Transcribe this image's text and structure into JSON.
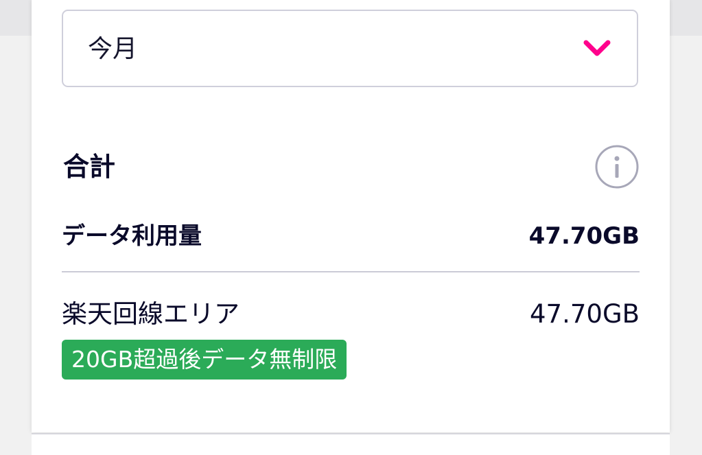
{
  "period_select": {
    "selected": "今月",
    "icon": "chevron-down-icon",
    "chevron_color": "#ff008c"
  },
  "summary": {
    "title": "合計",
    "info_icon": "info-icon",
    "data_usage_label": "データ利用量",
    "data_usage_value": "47.70GB"
  },
  "breakdown": {
    "area_label": "楽天回線エリア",
    "area_value": "47.70GB",
    "badge_text": "20GB超過後データ無制限",
    "badge_color": "#2bab58"
  }
}
